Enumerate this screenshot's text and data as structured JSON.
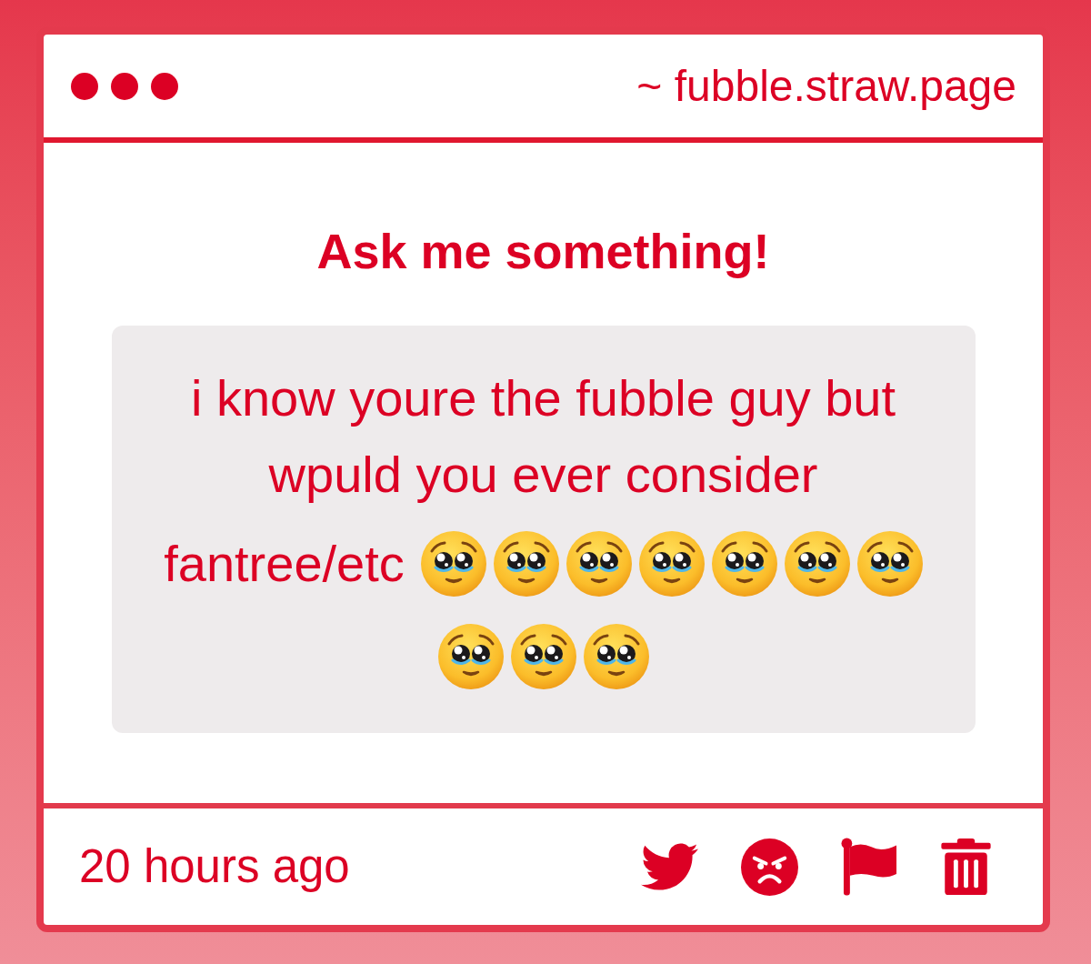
{
  "address": "~ fubble.straw.page",
  "prompt": {
    "title": "Ask me something!"
  },
  "question": {
    "text": "i know youre the fubble guy but wpuld you ever consider",
    "text_continued": "fantree/etc",
    "emojis": [
      {
        "kind": "pleading-face"
      },
      {
        "kind": "pleading-face"
      },
      {
        "kind": "pleading-face"
      },
      {
        "kind": "pleading-face"
      },
      {
        "kind": "pleading-face"
      },
      {
        "kind": "pleading-face"
      },
      {
        "kind": "pleading-face"
      },
      {
        "kind": "pleading-face"
      },
      {
        "kind": "pleading-face"
      },
      {
        "kind": "pleading-face"
      }
    ]
  },
  "footer": {
    "time": "20 hours ago"
  }
}
